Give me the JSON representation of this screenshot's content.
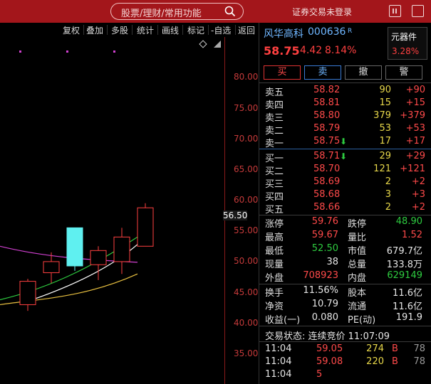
{
  "topbar": {
    "search_placeholder": "股票/理财/常用功能",
    "login_status": "证券交易未登录"
  },
  "toolbar": {
    "items": [
      "复权",
      "叠加",
      "多股",
      "统计",
      "画线",
      "标记",
      "-自选",
      "返回"
    ]
  },
  "chart": {
    "y_ticks": [
      "80.00",
      "75.00",
      "70.00",
      "65.00",
      "60.00",
      "55.00",
      "50.00",
      "45.00",
      "40.00",
      "35.00"
    ],
    "current_price_tag": "56.50",
    "colors": {
      "up": "#ff4040",
      "down": "#5ff0f0",
      "ma_white": "#ffffff",
      "ma_green": "#2ecc40",
      "ma_magenta": "#d040d0",
      "ma_yellow": "#e8c040",
      "axis": "#c43a3a"
    }
  },
  "chart_data": {
    "type": "candlestick",
    "ylim": [
      31,
      87
    ],
    "candles": [
      {
        "open": 43.0,
        "close": 46.8,
        "high": 47.2,
        "low": 42.0
      },
      {
        "open": 48.2,
        "close": 50.0,
        "high": 51.5,
        "low": 46.5
      },
      {
        "open": 55.5,
        "close": 49.3,
        "high": 55.5,
        "low": 48.5
      },
      {
        "open": 49.5,
        "close": 51.8,
        "high": 52.5,
        "low": 47.0
      },
      {
        "open": 50.0,
        "close": 54.0,
        "high": 55.5,
        "low": 48.0
      },
      {
        "open": 52.5,
        "close": 58.75,
        "high": 59.5,
        "low": 52.5
      }
    ]
  },
  "quote": {
    "name": "风华高科",
    "code": "000636",
    "badge": "R",
    "price": "58.75",
    "change": "4.42",
    "change_pct": "8.14%",
    "sector_name": "元器件",
    "sector_pct": "3.28%"
  },
  "buttons": {
    "buy": "买",
    "sell": "卖",
    "cancel": "撤",
    "alert": "警"
  },
  "order_book": {
    "asks": [
      {
        "label": "卖五",
        "price": "58.82",
        "vol": "90",
        "chg": "+90"
      },
      {
        "label": "卖四",
        "price": "58.81",
        "vol": "15",
        "chg": "+15"
      },
      {
        "label": "卖三",
        "price": "58.80",
        "vol": "379",
        "chg": "+379"
      },
      {
        "label": "卖二",
        "price": "58.79",
        "vol": "53",
        "chg": "+53"
      },
      {
        "label": "卖一",
        "price": "58.75",
        "vol": "17",
        "chg": "+17"
      }
    ],
    "bids": [
      {
        "label": "买一",
        "price": "58.71",
        "vol": "29",
        "chg": "+29"
      },
      {
        "label": "买二",
        "price": "58.70",
        "vol": "121",
        "chg": "+121"
      },
      {
        "label": "买三",
        "price": "58.69",
        "vol": "2",
        "chg": "+2"
      },
      {
        "label": "买四",
        "price": "58.68",
        "vol": "3",
        "chg": "+3"
      },
      {
        "label": "买五",
        "price": "58.66",
        "vol": "2",
        "chg": "+2"
      }
    ]
  },
  "stats": [
    {
      "l1": "涨停",
      "v1": "59.76",
      "c1": "red",
      "l2": "跌停",
      "v2": "48.90",
      "c2": "green"
    },
    {
      "l1": "最高",
      "v1": "59.67",
      "c1": "red",
      "l2": "量比",
      "v2": "1.52",
      "c2": "red"
    },
    {
      "l1": "最低",
      "v1": "52.50",
      "c1": "green",
      "l2": "市值",
      "v2": "679.7亿",
      "c2": "white"
    },
    {
      "l1": "现量",
      "v1": "38",
      "c1": "white",
      "l2": "总量",
      "v2": "133.8万",
      "c2": "white"
    },
    {
      "l1": "外盘",
      "v1": "708923",
      "c1": "red",
      "l2": "内盘",
      "v2": "629149",
      "c2": "green"
    }
  ],
  "stats2": [
    {
      "l1": "换手",
      "v1": "11.56%",
      "c1": "white",
      "l2": "股本",
      "v2": "11.6亿",
      "c2": "white"
    },
    {
      "l1": "净资",
      "v1": "10.79",
      "c1": "white",
      "l2": "流通",
      "v2": "11.6亿",
      "c2": "white"
    },
    {
      "l1": "收益(一)",
      "v1": "0.080",
      "c1": "white",
      "l2": "PE(动)",
      "v2": "191.9",
      "c2": "white"
    }
  ],
  "status": "交易状态: 连续竞价 11:07:09",
  "ticks": [
    {
      "time": "11:04",
      "price": "59.05",
      "vol": "274",
      "dir": "B",
      "cnt": "78"
    },
    {
      "time": "11:04",
      "price": "59.08",
      "vol": "220",
      "dir": "B",
      "cnt": "78"
    },
    {
      "time": "11:04",
      "price": "5",
      "vol": "",
      "dir": "",
      "cnt": ""
    }
  ]
}
